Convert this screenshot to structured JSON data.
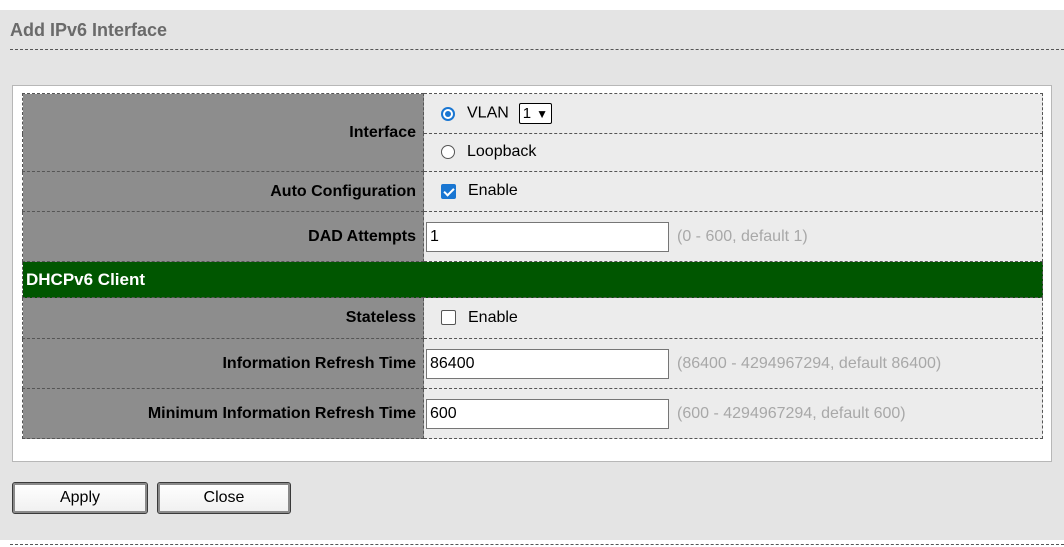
{
  "title": "Add IPv6 Interface",
  "form": {
    "interface": {
      "label": "Interface",
      "vlan_label": "VLAN",
      "vlan_value": "1",
      "vlan_selected": true,
      "loopback_label": "Loopback",
      "loopback_selected": false
    },
    "auto_configuration": {
      "label": "Auto Configuration",
      "option": "Enable",
      "checked": true
    },
    "dad_attempts": {
      "label": "DAD Attempts",
      "value": "1",
      "hint": "(0 - 600, default 1)"
    },
    "dhcpv6_section": "DHCPv6 Client",
    "stateless": {
      "label": "Stateless",
      "option": "Enable",
      "checked": false
    },
    "info_refresh": {
      "label": "Information Refresh Time",
      "value": "86400",
      "hint": "(86400 - 4294967294, default 86400)"
    },
    "min_info_refresh": {
      "label": "Minimum Information Refresh Time",
      "value": "600",
      "hint": "(600 - 4294967294, default 600)"
    }
  },
  "buttons": {
    "apply": "Apply",
    "close": "Close"
  },
  "colors": {
    "section_header": "#005600",
    "label_bg": "#8d8d8d",
    "accent": "#1976d2"
  }
}
